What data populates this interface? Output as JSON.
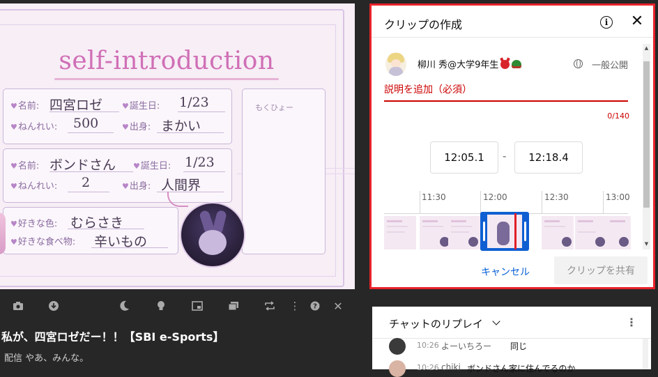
{
  "video": {
    "frame_title": "self-introduction",
    "card1": {
      "name_label": "名前:",
      "name_value": "四宮ロゼ",
      "birthday_label": "誕生日:",
      "birthday_value": "1/23",
      "age_label": "ねんれい:",
      "age_value": "500",
      "origin_label": "出身:",
      "origin_value": "まかい"
    },
    "card2": {
      "name_label": "名前:",
      "name_value": "ボンドさん",
      "birthday_label": "誕生日:",
      "birthday_value": "1/23",
      "age_label": "ねんれい:",
      "age_value": "2",
      "origin_label": "出身:",
      "origin_value": "人間界"
    },
    "card3": {
      "color_label": "好きな色:",
      "color_value": "むらさき",
      "food_label": "好きな食べ物:",
      "food_value": "辛いもの"
    },
    "memo_label": "もくひょー"
  },
  "controls": {
    "icons": [
      "camera-icon",
      "download-icon",
      "moon-icon",
      "lightbulb-icon",
      "miniplayer-icon",
      "theater-icon",
      "loop-icon",
      "more-icon",
      "help-icon",
      "close-icon"
    ]
  },
  "video_info": {
    "title": "私が、四宮ロゼだー！！【SBI e-Sports】",
    "description": "配信 やあ、みんな。"
  },
  "clip": {
    "title": "クリップの作成",
    "user_name": "柳川 秀@大学9年生",
    "visibility": "一般公開",
    "description_placeholder": "説明を追加（必須）",
    "char_count": "0/140",
    "start_time": "12:05.1",
    "end_time": "12:18.4",
    "time_separator": "-",
    "timeline_labels": [
      "11:30",
      "12:00",
      "12:30",
      "13:00"
    ],
    "cancel_label": "キャンセル",
    "share_label": "クリップを共有"
  },
  "chat": {
    "title": "チャットのリプレイ",
    "messages": [
      {
        "time": "10:26",
        "author": "よーいちろー",
        "text": "同じ"
      },
      {
        "time": "10:26",
        "author": "chiki",
        "text": "ボンドさん家に住んでるのか"
      }
    ]
  },
  "colors": {
    "clip_border": "#e8222a",
    "required_red": "#cc0000",
    "selection_blue": "#0f5fd2",
    "link_blue": "#065fd4",
    "page_bg": "#272727"
  }
}
